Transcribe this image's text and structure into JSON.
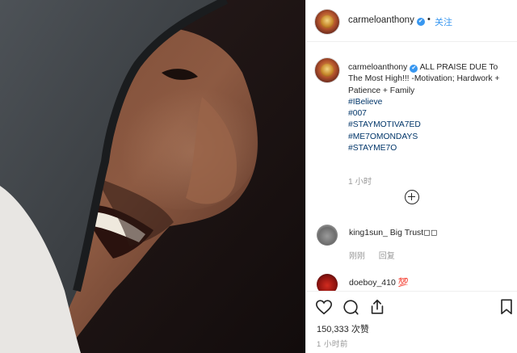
{
  "post": {
    "username": "carmeloanthony",
    "verified_mark": "✔",
    "separator": "•",
    "follow_label": "关注"
  },
  "caption": {
    "username": "carmeloanthony",
    "text": "ALL PRAISE DUE To The Most High!!! -Motivation; Hardwork + Patience + Family",
    "hashtags": [
      "#IBelieve",
      "#007",
      "#STAYMOTIVA7ED",
      "#ME7OMONDAYS",
      "#STAYME7O"
    ],
    "time": "1 小时"
  },
  "comments": [
    {
      "username": "king1sun_",
      "text": "Big Trust◻◻",
      "meta": [
        "刚刚",
        "回复"
      ]
    },
    {
      "username": "doeboy_410",
      "text": "💯"
    }
  ],
  "actions": {
    "icons": [
      "heart-icon",
      "comment-icon",
      "share-icon",
      "bookmark-icon"
    ],
    "likes": "150,333 次赞",
    "time": "1 小时前"
  },
  "colors": {
    "link": "#3897f0",
    "hashtag": "#003569",
    "muted": "#999999",
    "text": "#262626"
  }
}
